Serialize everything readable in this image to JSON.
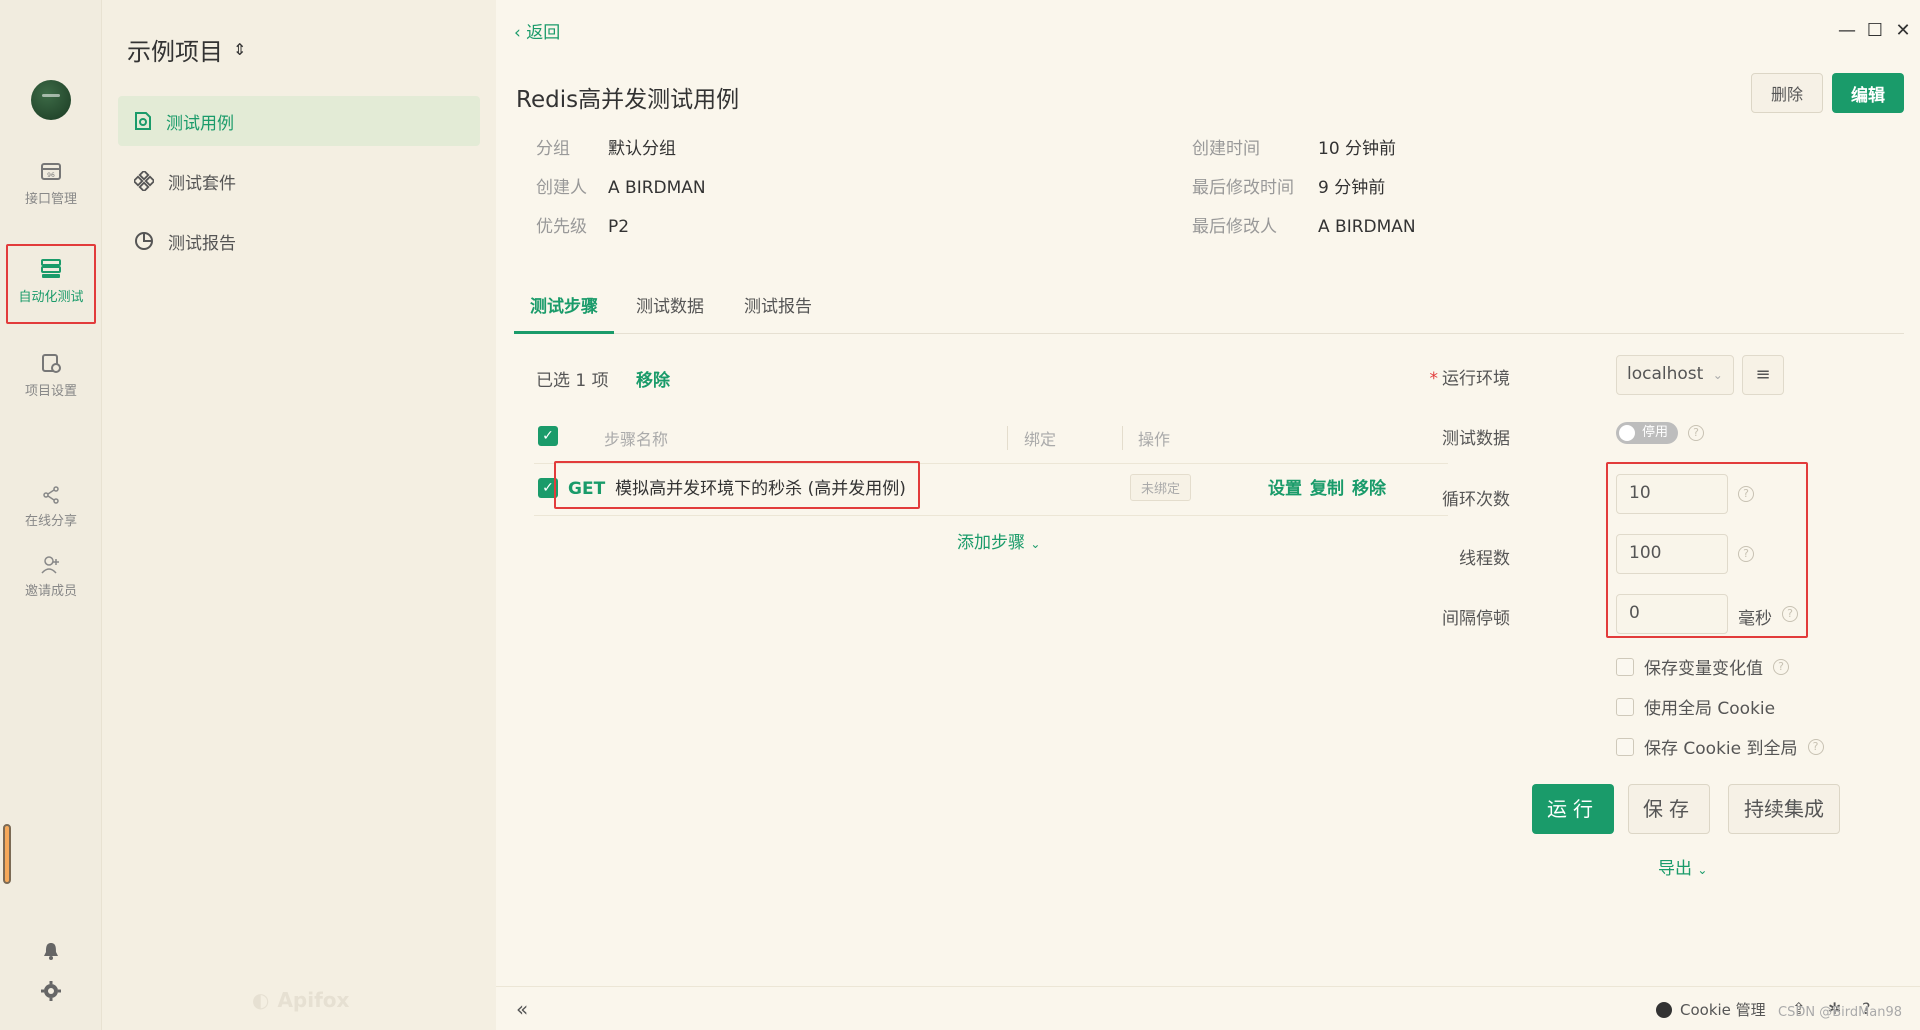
{
  "rail": {
    "items": [
      {
        "label": "接口管理"
      },
      {
        "label": "自动化测试"
      },
      {
        "label": "项目设置"
      },
      {
        "label": "在线分享"
      },
      {
        "label": "邀请成员"
      }
    ]
  },
  "project": {
    "title": "示例项目",
    "nav": [
      {
        "label": "测试用例"
      },
      {
        "label": "测试套件"
      },
      {
        "label": "测试报告"
      }
    ],
    "brand": "Apifox"
  },
  "main": {
    "back": "返回",
    "title": "Redis高并发测试用例",
    "delete_label": "删除",
    "edit_label": "编辑",
    "meta": {
      "group_k": "分组",
      "group_v": "默认分组",
      "creator_k": "创建人",
      "creator_v": "A BIRDMAN",
      "priority_k": "优先级",
      "priority_v": "P2",
      "created_k": "创建时间",
      "created_v": "10 分钟前",
      "modified_k": "最后修改时间",
      "modified_v": "9 分钟前",
      "modifier_k": "最后修改人",
      "modifier_v": "A BIRDMAN"
    },
    "tabs": [
      {
        "label": "测试步骤"
      },
      {
        "label": "测试数据"
      },
      {
        "label": "测试报告"
      }
    ],
    "selected_text": "已选 1 项",
    "remove_label": "移除",
    "table": {
      "headers": [
        "步骤名称",
        "绑定",
        "操作"
      ],
      "rows": [
        {
          "method": "GET",
          "name": "模拟高并发环境下的秒杀 (高并发用例)",
          "binding": "未绑定",
          "ops": [
            "设置",
            "复制",
            "移除"
          ]
        }
      ]
    },
    "add_step": "添加步骤"
  },
  "config": {
    "env_label": "运行环境",
    "env_value": "localhost",
    "test_data_label": "测试数据",
    "toggle_label": "停用",
    "loop_label": "循环次数",
    "loop_value": "10",
    "threads_label": "线程数",
    "threads_value": "100",
    "interval_label": "间隔停顿",
    "interval_value": "0",
    "interval_unit": "毫秒",
    "checks": [
      {
        "label": "保存变量变化值"
      },
      {
        "label": "使用全局 Cookie"
      },
      {
        "label": "保存 Cookie 到全局"
      }
    ],
    "run_label": "运行",
    "save_label": "保存",
    "ci_label": "持续集成",
    "export_label": "导出"
  },
  "footer": {
    "cookie_label": "Cookie 管理",
    "watermark": "CSDN @BirdMan98"
  },
  "colors": {
    "accent": "#1a9b6a",
    "highlight_box": "#e23b3b",
    "bg": "#faf6ec"
  }
}
